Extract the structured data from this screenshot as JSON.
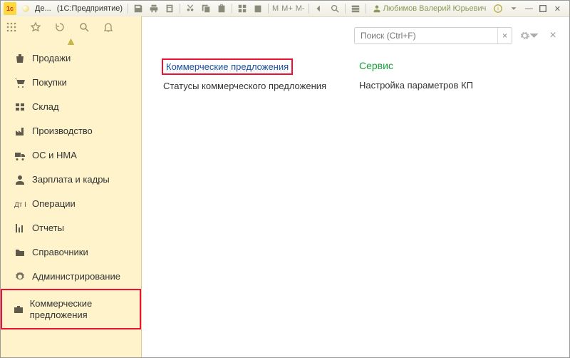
{
  "titlebar": {
    "app_short": "Де...",
    "app_suffix": "(1С:Предприятие)",
    "user_name": "Любимов Валерий Юрьевич",
    "mem_m": "M",
    "mem_mplus": "M+",
    "mem_mminus": "M-"
  },
  "search": {
    "placeholder": "Поиск (Ctrl+F)"
  },
  "sidebar": {
    "items": [
      {
        "label": "Продажи"
      },
      {
        "label": "Покупки"
      },
      {
        "label": "Склад"
      },
      {
        "label": "Производство"
      },
      {
        "label": "ОС и НМА"
      },
      {
        "label": "Зарплата и кадры"
      },
      {
        "label": "Операции"
      },
      {
        "label": "Отчеты"
      },
      {
        "label": "Справочники"
      },
      {
        "label": "Администрирование"
      },
      {
        "label": "Коммерческие предложения"
      }
    ]
  },
  "main": {
    "left_links": [
      "Коммерческие предложения",
      "Статусы коммерческого предложения"
    ],
    "service_heading": "Сервис",
    "right_links": [
      "Настройка параметров КП"
    ]
  }
}
